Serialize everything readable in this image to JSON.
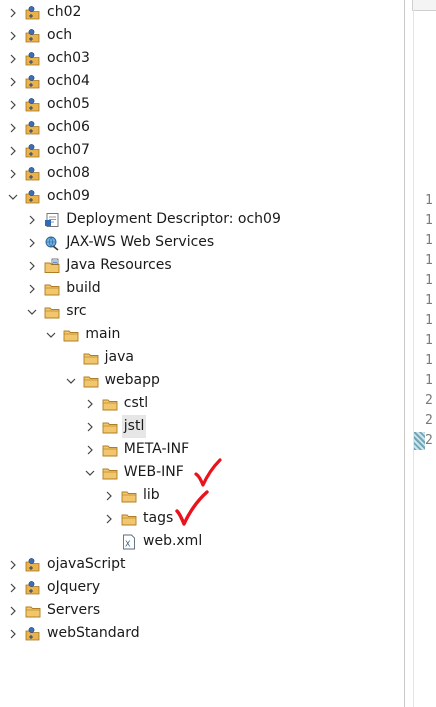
{
  "project_explorer": {
    "rows": [
      {
        "label": "ch02",
        "icon": "project-icon",
        "expanded": false
      },
      {
        "label": "och",
        "icon": "project-icon",
        "expanded": false
      },
      {
        "label": "och03",
        "icon": "project-icon",
        "expanded": false
      },
      {
        "label": "och04",
        "icon": "project-icon",
        "expanded": false
      },
      {
        "label": "och05",
        "icon": "project-icon",
        "expanded": false
      },
      {
        "label": "och06",
        "icon": "project-icon",
        "expanded": false
      },
      {
        "label": "och07",
        "icon": "project-icon",
        "expanded": false
      },
      {
        "label": "och08",
        "icon": "project-icon",
        "expanded": false
      },
      {
        "label": "och09",
        "icon": "project-icon",
        "expanded": true
      },
      {
        "label": "Deployment Descriptor: och09",
        "icon": "deployment-descriptor-icon",
        "expanded": false
      },
      {
        "label": "JAX-WS Web Services",
        "icon": "web-services-icon",
        "expanded": false
      },
      {
        "label": "Java Resources",
        "icon": "java-resources-icon",
        "expanded": false
      },
      {
        "label": "build",
        "icon": "folder-icon",
        "expanded": false
      },
      {
        "label": "src",
        "icon": "folder-icon",
        "expanded": true
      },
      {
        "label": "main",
        "icon": "folder-icon",
        "expanded": true
      },
      {
        "label": "java",
        "icon": "folder-icon",
        "expanded": null
      },
      {
        "label": "webapp",
        "icon": "folder-icon",
        "expanded": true
      },
      {
        "label": "cstl",
        "icon": "folder-icon",
        "expanded": false
      },
      {
        "label": "jstl",
        "icon": "folder-icon",
        "expanded": false,
        "selected": true
      },
      {
        "label": "META-INF",
        "icon": "folder-icon",
        "expanded": false
      },
      {
        "label": "WEB-INF",
        "icon": "folder-icon",
        "expanded": true,
        "annotated": true
      },
      {
        "label": "lib",
        "icon": "folder-icon",
        "expanded": false
      },
      {
        "label": "tags",
        "icon": "folder-icon",
        "expanded": false,
        "annotated": true
      },
      {
        "label": "web.xml",
        "icon": "xml-file-icon",
        "expanded": null
      },
      {
        "label": "ojavaScript",
        "icon": "project-icon",
        "expanded": false
      },
      {
        "label": "oJquery",
        "icon": "project-icon",
        "expanded": false
      },
      {
        "label": "Servers",
        "icon": "folder-icon",
        "expanded": false
      },
      {
        "label": "webStandard",
        "icon": "project-icon",
        "expanded": false
      }
    ]
  },
  "editor_gutter": {
    "line_numbers": [
      "1",
      "1",
      "1",
      "1",
      "1",
      "1",
      "1",
      "1",
      "1",
      "1",
      "2",
      "2",
      "2"
    ]
  },
  "colors": {
    "selection": "#e6e6e6",
    "annotation_check": "#e8131b",
    "folder": "#e8b04a",
    "marker": "#6fa7b9"
  }
}
